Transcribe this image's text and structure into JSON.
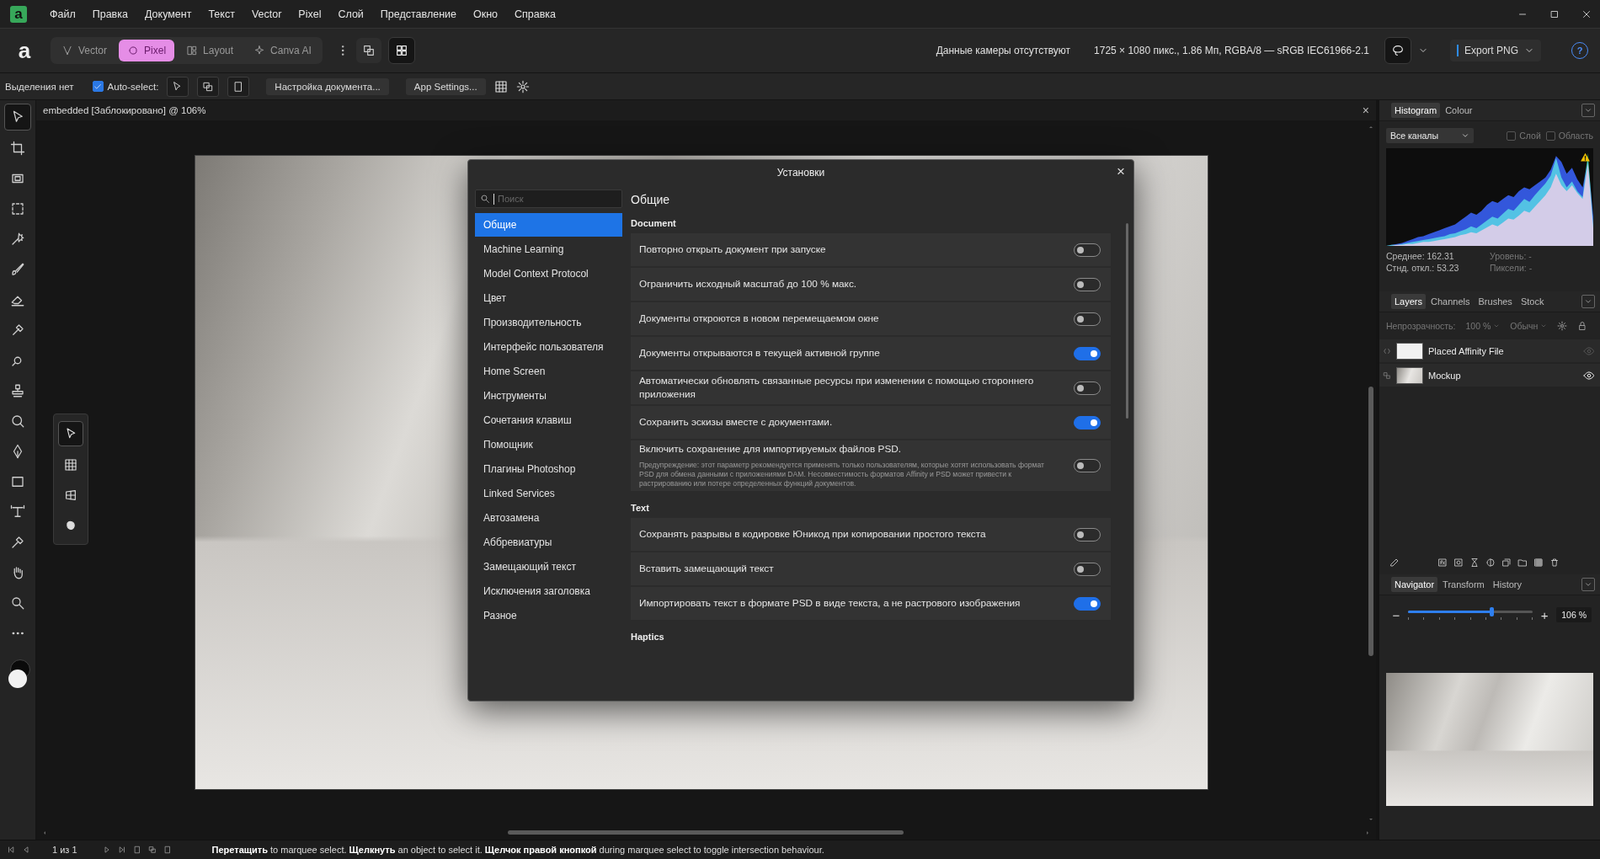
{
  "app_icon": "a",
  "menu": [
    "Файл",
    "Правка",
    "Документ",
    "Текст",
    "Vector",
    "Pixel",
    "Слой",
    "Представление",
    "Окно",
    "Справка"
  ],
  "toolbar": {
    "logo": "a",
    "personas": [
      {
        "label": "Vector",
        "kind": "vector",
        "selected": false
      },
      {
        "label": "Pixel",
        "kind": "pixel",
        "selected": true
      },
      {
        "label": "Layout",
        "kind": "layout",
        "selected": false
      },
      {
        "label": "Canva AI",
        "kind": "sparkle",
        "selected": false
      }
    ],
    "camera": "Данные камеры отсутствуют",
    "doc_info": "1725 × 1080 пикс., 1.86 Мп, RGBA/8 — sRGB IEC61966-2.1",
    "export": "Export PNG",
    "help": "?"
  },
  "context_bar": {
    "selection": "Выделения нет",
    "auto_select": {
      "label": "Auto-select:",
      "checked": true
    },
    "buttons": [
      "Настройка документа...",
      "App Settings..."
    ]
  },
  "tools": [
    {
      "kind": "move",
      "selected": true
    },
    {
      "kind": "crop",
      "selected": false
    },
    {
      "kind": "perspective",
      "selected": false
    },
    {
      "kind": "marquee",
      "selected": false
    },
    {
      "kind": "selbrush",
      "selected": false
    },
    {
      "kind": "brush",
      "selected": false
    },
    {
      "kind": "eraser",
      "selected": false
    },
    {
      "kind": "smudge",
      "selected": false
    },
    {
      "kind": "dodge",
      "selected": false
    },
    {
      "kind": "clone",
      "selected": false
    },
    {
      "kind": "retouch",
      "selected": false
    },
    {
      "kind": "pen",
      "selected": false
    },
    {
      "kind": "rectangle",
      "selected": false
    },
    {
      "kind": "text",
      "selected": false
    },
    {
      "kind": "picker",
      "selected": false
    },
    {
      "kind": "hand",
      "selected": false
    },
    {
      "kind": "zoom",
      "selected": false
    },
    {
      "kind": "more",
      "selected": false
    }
  ],
  "sub_tools": [
    {
      "kind": "pointer",
      "selected": true
    },
    {
      "kind": "grid",
      "selected": false
    },
    {
      "kind": "mesh",
      "selected": false
    },
    {
      "kind": "blob",
      "selected": false
    }
  ],
  "document_tab": {
    "title": "embedded [Заблокировано] @ 106%",
    "close": "×"
  },
  "dialog": {
    "title": "Установки",
    "close": "×",
    "search": {
      "placeholder": "Поиск"
    },
    "categories": [
      {
        "label": "Общие",
        "selected": true
      },
      {
        "label": "Machine Learning",
        "selected": false
      },
      {
        "label": "Model Context Protocol",
        "selected": false
      },
      {
        "label": "Цвет",
        "selected": false
      },
      {
        "label": "Производительность",
        "selected": false
      },
      {
        "label": "Интерфейс пользователя",
        "selected": false
      },
      {
        "label": "Home Screen",
        "selected": false
      },
      {
        "label": "Инструменты",
        "selected": false
      },
      {
        "label": "Сочетания клавиш",
        "selected": false
      },
      {
        "label": "Помощник",
        "selected": false
      },
      {
        "label": "Плагины Photoshop",
        "selected": false
      },
      {
        "label": "Linked Services",
        "selected": false
      },
      {
        "label": "Автозамена",
        "selected": false
      },
      {
        "label": "Аббревиатуры",
        "selected": false
      },
      {
        "label": "Замещающий текст",
        "selected": false
      },
      {
        "label": "Исключения заголовка",
        "selected": false
      },
      {
        "label": "Разное",
        "selected": false
      }
    ],
    "page_title": "Общие",
    "sections": [
      {
        "heading": "Document",
        "settings": [
          {
            "label": "Повторно открыть документ при запуске",
            "on": false,
            "description": ""
          },
          {
            "label": "Ограничить исходный масштаб до 100 % макс.",
            "on": false,
            "description": ""
          },
          {
            "label": "Документы откроются в новом перемещаемом окне",
            "on": false,
            "description": ""
          },
          {
            "label": "Документы открываются в текущей активной группе",
            "on": true,
            "description": ""
          },
          {
            "label": "Автоматически обновлять связанные ресурсы при изменении с помощью стороннего приложения",
            "on": false,
            "description": ""
          },
          {
            "label": "Сохранить эскизы вместе с документами.",
            "on": true,
            "description": ""
          },
          {
            "label": "Включить сохранение для импортируемых файлов PSD.",
            "on": false,
            "description": "Предупреждение: этот параметр рекомендуется применять только пользователям, которые хотят использовать формат PSD для обмена данными с приложениями DAM. Несовместимость форматов Affinity и PSD может привести к растрированию или потере определенных функций документов."
          }
        ]
      },
      {
        "heading": "Text",
        "settings": [
          {
            "label": "Сохранять разрывы в кодировке Юникод при копировании простого текста",
            "on": false,
            "description": ""
          },
          {
            "label": "Вставить замещающий текст",
            "on": false,
            "description": ""
          },
          {
            "label": "Импортировать текст в формате PSD в виде текста, а не растрового изображения",
            "on": true,
            "description": ""
          }
        ]
      },
      {
        "heading": "Haptics",
        "settings": []
      }
    ]
  },
  "histogram_panel": {
    "tabs": [
      {
        "label": "Histogram",
        "selected": true
      },
      {
        "label": "Colour",
        "selected": false
      }
    ],
    "channel": "Все каналы",
    "checks": [
      {
        "label": "Слой",
        "checked": false
      },
      {
        "label": "Область",
        "checked": false
      }
    ],
    "series": [
      {
        "name": "blue",
        "color": "#2f5cff",
        "values": [
          0,
          1,
          2,
          3,
          5,
          7,
          9,
          10,
          12,
          14,
          16,
          18,
          20,
          22,
          26,
          30,
          34,
          32,
          36,
          42,
          46,
          44,
          48,
          52,
          50,
          56,
          60,
          58,
          62,
          66,
          70,
          78,
          92,
          86,
          74,
          80,
          68,
          60,
          88,
          30
        ]
      },
      {
        "name": "green",
        "color": "#2fbf4a",
        "values": [
          0,
          1,
          1,
          2,
          3,
          4,
          5,
          6,
          7,
          8,
          9,
          10,
          12,
          13,
          15,
          17,
          20,
          18,
          22,
          26,
          30,
          28,
          33,
          38,
          36,
          42,
          48,
          45,
          52,
          58,
          64,
          72,
          90,
          70,
          60,
          66,
          56,
          50,
          95,
          22
        ]
      },
      {
        "name": "red",
        "color": "#e0302a",
        "values": [
          0,
          0,
          1,
          1,
          2,
          2,
          3,
          4,
          4,
          5,
          6,
          7,
          8,
          9,
          11,
          12,
          14,
          13,
          16,
          19,
          22,
          20,
          24,
          28,
          27,
          31,
          36,
          34,
          40,
          46,
          52,
          60,
          74,
          62,
          56,
          62,
          54,
          48,
          84,
          18
        ]
      }
    ],
    "stats": [
      {
        "text": "Среднее: 162.31",
        "dim": false
      },
      {
        "text": "Уровень: -",
        "dim": true
      },
      {
        "text": "Стнд. откл.: 53.23",
        "dim": false
      },
      {
        "text": "Пиксели: -",
        "dim": true
      }
    ]
  },
  "layers_panel": {
    "tabs": [
      {
        "label": "Layers",
        "selected": true
      },
      {
        "label": "Channels",
        "selected": false
      },
      {
        "label": "Brushes",
        "selected": false
      },
      {
        "label": "Stock",
        "selected": false
      }
    ],
    "opacity_label": "Непрозрачность:",
    "opacity": "100 %",
    "blend": "Обычн",
    "layers": [
      {
        "name": "Placed Affinity File",
        "kind": "placed",
        "visible": false
      },
      {
        "name": "Mockup",
        "kind": "image",
        "visible": true
      }
    ],
    "actions": [
      {
        "kind": "edit"
      },
      {
        "kind": "fx"
      },
      {
        "kind": "mask"
      },
      {
        "kind": "hourglass"
      },
      {
        "kind": "adjust"
      },
      {
        "kind": "group"
      },
      {
        "kind": "folder"
      },
      {
        "kind": "checker"
      },
      {
        "kind": "trash"
      }
    ]
  },
  "navigator_panel": {
    "tabs": [
      {
        "label": "Navigator",
        "selected": true
      },
      {
        "label": "Transform",
        "selected": false
      },
      {
        "label": "History",
        "selected": false
      }
    ],
    "minus": "−",
    "plus": "+",
    "zoom_level": 0.67,
    "zoom": "106 %"
  },
  "status_bar": {
    "page": "1 из 1",
    "hint": [
      {
        "text": "Перетащить",
        "bold": true
      },
      {
        "text": " to marquee select. ",
        "bold": false
      },
      {
        "text": "Щелкнуть",
        "bold": true
      },
      {
        "text": " an object to select it. ",
        "bold": false
      },
      {
        "text": "Щелчок правой кнопкой",
        "bold": true
      },
      {
        "text": " during marquee select to toggle intersection behaviour.",
        "bold": false
      }
    ]
  }
}
